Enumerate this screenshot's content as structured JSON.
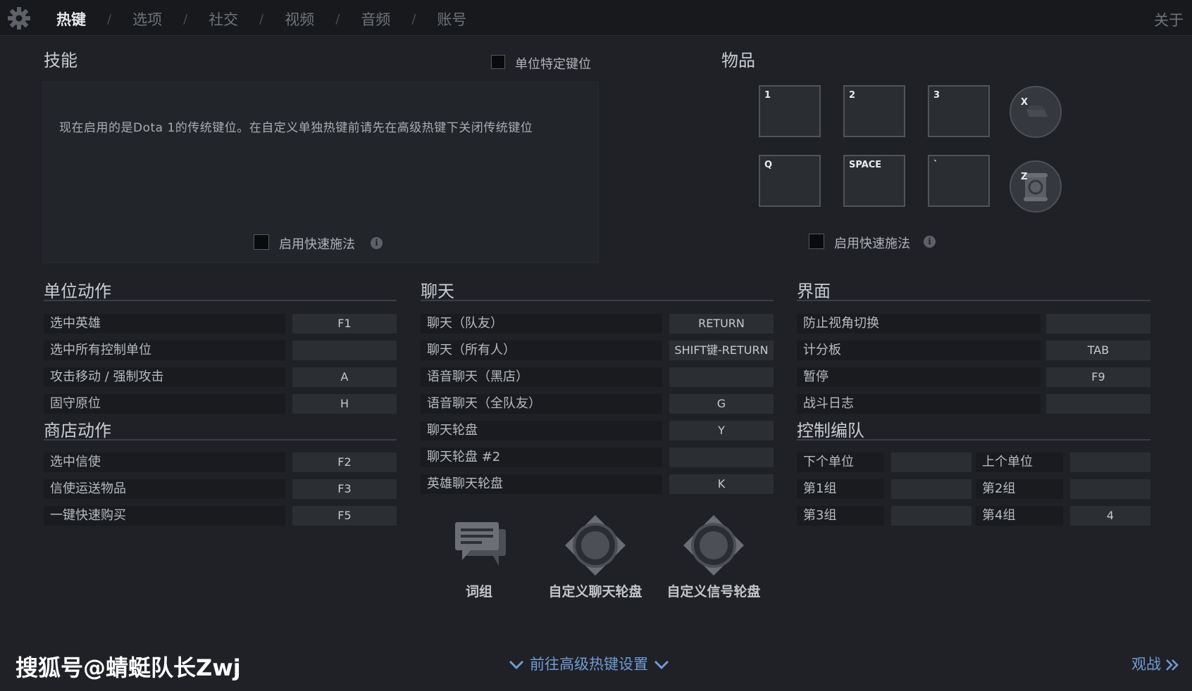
{
  "topbar": {
    "tabs": [
      "热键",
      "选项",
      "社交",
      "视频",
      "音频",
      "账号"
    ],
    "separator": "/",
    "about": "关于"
  },
  "skills": {
    "title": "技能",
    "unit_specific_label": "单位特定键位",
    "description": "现在启用的是Dota 1的传统键位。在自定义单独热键前请先在高级热键下关闭传统键位",
    "quickcast_label": "启用快速施法"
  },
  "items": {
    "title": "物品",
    "slots": [
      "1",
      "2",
      "3",
      "Q",
      "SPACE",
      "`"
    ],
    "round_keys": [
      "X",
      "Z"
    ],
    "quickcast_label": "启用快速施法"
  },
  "unit_actions": {
    "title": "单位动作",
    "rows": [
      {
        "label": "选中英雄",
        "key": "F1"
      },
      {
        "label": "选中所有控制单位",
        "key": ""
      },
      {
        "label": "攻击移动 / 强制攻击",
        "key": "A"
      },
      {
        "label": "固守原位",
        "key": "H"
      }
    ]
  },
  "shop_actions": {
    "title": "商店动作",
    "rows": [
      {
        "label": "选中信使",
        "key": "F2"
      },
      {
        "label": "信使运送物品",
        "key": "F3"
      },
      {
        "label": "一键快速购买",
        "key": "F5"
      }
    ]
  },
  "chat": {
    "title": "聊天",
    "rows": [
      {
        "label": "聊天（队友）",
        "key": "RETURN"
      },
      {
        "label": "聊天（所有人）",
        "key": "SHIFT键-RETURN"
      },
      {
        "label": "语音聊天（黑店）",
        "key": ""
      },
      {
        "label": "语音聊天（全队友）",
        "key": "G"
      },
      {
        "label": "聊天轮盘",
        "key": "Y"
      },
      {
        "label": "聊天轮盘 #2",
        "key": ""
      },
      {
        "label": "英雄聊天轮盘",
        "key": "K"
      }
    ],
    "buttons": [
      "词组",
      "自定义聊天轮盘",
      "自定义信号轮盘"
    ]
  },
  "interface": {
    "title": "界面",
    "rows": [
      {
        "label": "防止视角切换",
        "key": ""
      },
      {
        "label": "计分板",
        "key": "TAB"
      },
      {
        "label": "暂停",
        "key": "F9"
      },
      {
        "label": "战斗日志",
        "key": ""
      }
    ]
  },
  "control_groups": {
    "title": "控制编队",
    "rows": [
      [
        {
          "label": "下个单位",
          "key": ""
        },
        {
          "label": "上个单位",
          "key": ""
        }
      ],
      [
        {
          "label": "第1组",
          "key": ""
        },
        {
          "label": "第2组",
          "key": ""
        }
      ],
      [
        {
          "label": "第3组",
          "key": ""
        },
        {
          "label": "第4组",
          "key": "4"
        }
      ]
    ]
  },
  "footer": {
    "advanced_link": "前往高级热键设置",
    "spectate_link": "观战",
    "watermark": "搜狐号@蜻蜓队长Zwj"
  },
  "colors": {
    "background": "#1f2126",
    "accent_link": "#6f9dd6"
  }
}
